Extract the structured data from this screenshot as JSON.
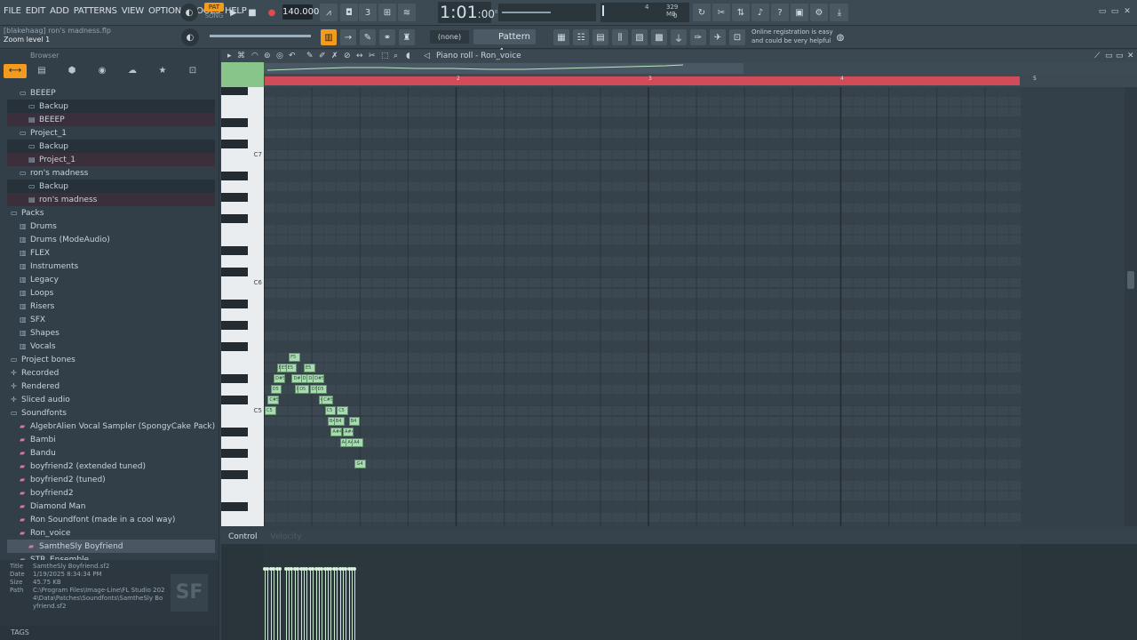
{
  "menu": [
    "FILE",
    "EDIT",
    "ADD",
    "PATTERNS",
    "VIEW",
    "OPTIONS",
    "TOOLS",
    "HELP"
  ],
  "transport": {
    "pat_label": "PAT",
    "song_label": "SONG",
    "tempo": "140.000",
    "time_main": "1:01",
    "time_ticks": ":00",
    "time_unit": "B:S:T",
    "cpu_value": "4",
    "ram_value": "329 MB",
    "voices_value": "0"
  },
  "project": {
    "user_file": "[blakehaag] ron's madness.flp",
    "hint": "Zoom level 1"
  },
  "pattern_selector": {
    "none_label": "(none)",
    "pattern": "Pattern 4"
  },
  "registration": "Online registration is easy and could be very helpful",
  "browser": {
    "title": "Browser",
    "items": [
      {
        "label": "BEEEP",
        "indent": 1,
        "kind": "project-folder"
      },
      {
        "label": "Backup",
        "indent": 2,
        "kind": "folder",
        "state": "sel"
      },
      {
        "label": "BEEEP",
        "indent": 2,
        "kind": "file",
        "state": "hl"
      },
      {
        "label": "Project_1",
        "indent": 1,
        "kind": "project-folder"
      },
      {
        "label": "Backup",
        "indent": 2,
        "kind": "folder",
        "state": "sel"
      },
      {
        "label": "Project_1",
        "indent": 2,
        "kind": "file",
        "state": "hl"
      },
      {
        "label": "ron's madness",
        "indent": 1,
        "kind": "project-folder"
      },
      {
        "label": "Backup",
        "indent": 2,
        "kind": "folder",
        "state": "sel"
      },
      {
        "label": "ron's madness",
        "indent": 2,
        "kind": "file",
        "state": "hl"
      },
      {
        "label": "Packs",
        "indent": 0,
        "kind": "folder"
      },
      {
        "label": "Drums",
        "indent": 1,
        "kind": "pack"
      },
      {
        "label": "Drums (ModeAudio)",
        "indent": 1,
        "kind": "pack"
      },
      {
        "label": "FLEX",
        "indent": 1,
        "kind": "pack"
      },
      {
        "label": "Instruments",
        "indent": 1,
        "kind": "pack"
      },
      {
        "label": "Legacy",
        "indent": 1,
        "kind": "pack"
      },
      {
        "label": "Loops",
        "indent": 1,
        "kind": "pack"
      },
      {
        "label": "Risers",
        "indent": 1,
        "kind": "pack"
      },
      {
        "label": "SFX",
        "indent": 1,
        "kind": "pack"
      },
      {
        "label": "Shapes",
        "indent": 1,
        "kind": "pack"
      },
      {
        "label": "Vocals",
        "indent": 1,
        "kind": "pack"
      },
      {
        "label": "Project bones",
        "indent": 0,
        "kind": "folder"
      },
      {
        "label": "Recorded",
        "indent": 0,
        "kind": "plus"
      },
      {
        "label": "Rendered",
        "indent": 0,
        "kind": "plus"
      },
      {
        "label": "Sliced audio",
        "indent": 0,
        "kind": "plus"
      },
      {
        "label": "Soundfonts",
        "indent": 0,
        "kind": "folder"
      },
      {
        "label": "AlgebrAlien Vocal Sampler (SpongyCake Pack)",
        "indent": 1,
        "kind": "sf"
      },
      {
        "label": "Bambi",
        "indent": 1,
        "kind": "sf"
      },
      {
        "label": "Bandu",
        "indent": 1,
        "kind": "sf"
      },
      {
        "label": "boyfriend2 (extended tuned)",
        "indent": 1,
        "kind": "sf"
      },
      {
        "label": "boyfriend2 (tuned)",
        "indent": 1,
        "kind": "sf"
      },
      {
        "label": "boyfriend2",
        "indent": 1,
        "kind": "sf"
      },
      {
        "label": "Diamond Man",
        "indent": 1,
        "kind": "sf"
      },
      {
        "label": "Ron Soundfont (made in a cool way)",
        "indent": 1,
        "kind": "sf"
      },
      {
        "label": "Ron_voice",
        "indent": 1,
        "kind": "sf"
      },
      {
        "label": "SamtheSly Boyfriend",
        "indent": 2,
        "kind": "sf",
        "state": "sfsel"
      },
      {
        "label": "STR_Ensemble",
        "indent": 1,
        "kind": "sf"
      }
    ],
    "info": {
      "title_label": "Title",
      "title_value": "SamtheSly Boyfriend.sf2",
      "date_label": "Date",
      "date_value": "1/19/2025 8:34:34 PM",
      "size_label": "Size",
      "size_value": "45.75 KB",
      "path_label": "Path",
      "path_value": "C:\\Program Files\\Image-Line\\FL Studio 2024\\Data\\Patches\\Soundfonts\\SamtheSly Boyfriend.sf2",
      "badge": "SF"
    },
    "tags_label": "TAGS"
  },
  "piano_roll": {
    "title": "Piano roll - Ron_voice",
    "bars": [
      "2",
      "3",
      "4",
      "5"
    ],
    "key_labels": [
      "C7",
      "C6",
      "C5"
    ],
    "control_label": "Control",
    "velocity_label": "Velocity",
    "notes": [
      {
        "t": 0.0,
        "p": "C5"
      },
      {
        "t": 0.25,
        "p": "C#5"
      },
      {
        "t": 0.5,
        "p": "D5"
      },
      {
        "t": 0.75,
        "p": "D#5"
      },
      {
        "t": 1.0,
        "p": "E5"
      },
      {
        "t": 1.25,
        "p": "E5"
      },
      {
        "t": 1.75,
        "p": "E5"
      },
      {
        "t": 2.0,
        "p": "F5"
      },
      {
        "t": 2.25,
        "p": "D#5"
      },
      {
        "t": 2.5,
        "p": "D5"
      },
      {
        "t": 2.75,
        "p": "D5"
      },
      {
        "t": 3.0,
        "p": "D#5"
      },
      {
        "t": 3.25,
        "p": "E5"
      },
      {
        "t": 3.5,
        "p": "D#5"
      },
      {
        "t": 3.75,
        "p": "D5"
      },
      {
        "t": 4.0,
        "p": "D#5"
      },
      {
        "t": 4.25,
        "p": "D5"
      },
      {
        "t": 4.5,
        "p": "C#5"
      },
      {
        "t": 4.75,
        "p": "C#5"
      },
      {
        "t": 5.0,
        "p": "C5"
      },
      {
        "t": 5.25,
        "p": "B4"
      },
      {
        "t": 5.5,
        "p": "A#4"
      },
      {
        "t": 5.75,
        "p": "B4"
      },
      {
        "t": 6.0,
        "p": "C5"
      },
      {
        "t": 6.25,
        "p": "A4"
      },
      {
        "t": 6.5,
        "p": "A#4"
      },
      {
        "t": 6.75,
        "p": "A4"
      },
      {
        "t": 7.0,
        "p": "B4"
      },
      {
        "t": 7.25,
        "p": "A4"
      },
      {
        "t": 7.5,
        "p": "G4"
      }
    ]
  }
}
